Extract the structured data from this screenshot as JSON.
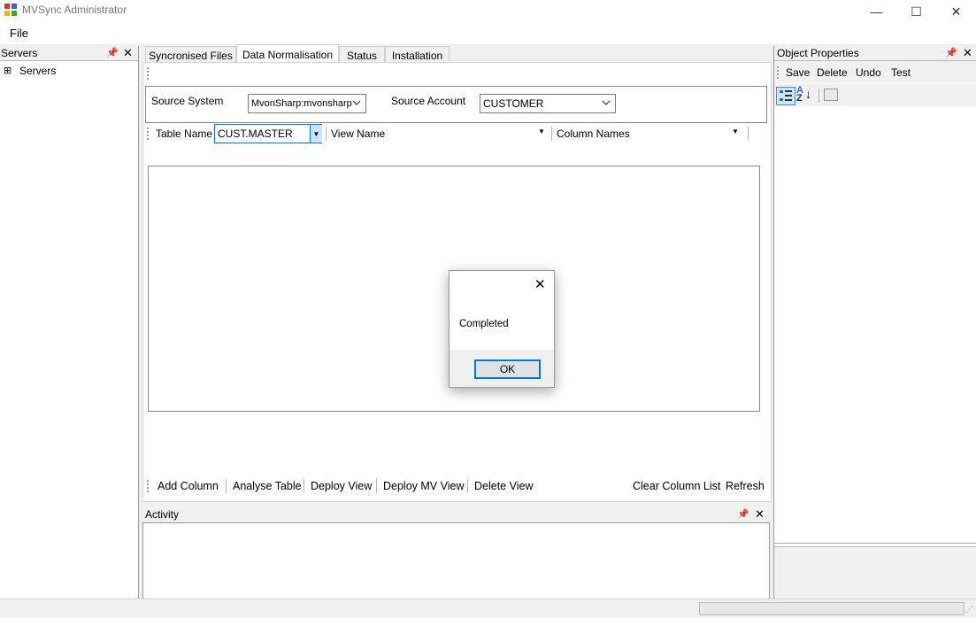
{
  "window": {
    "title": "MVSync Administrator"
  },
  "menu": {
    "file": "File"
  },
  "servers": {
    "title": "Servers",
    "tree_root": "Servers",
    "expander": "⊞"
  },
  "tabs": [
    "Syncronised Files",
    "Data Normalisation",
    "Status",
    "Installation"
  ],
  "form": {
    "source_system_label": "Source System",
    "source_system_value": "MvonSharp:mvonsharp",
    "source_account_label": "Source Account",
    "source_account_value": "CUSTOMER",
    "table_name_label": "Table Name",
    "table_name_value": "CUST.MASTER",
    "view_name_label": "View Name",
    "column_names_label": "Column Names"
  },
  "actions": [
    "Add Column",
    "Analyse Table",
    "Deploy View",
    "Deploy MV View",
    "Delete View"
  ],
  "actions_right": [
    "Clear Column List",
    "Refresh"
  ],
  "activity": {
    "title": "Activity"
  },
  "properties": {
    "title": "Object Properties",
    "toolbar": [
      "Save",
      "Delete",
      "Undo",
      "Test"
    ]
  },
  "dialog": {
    "message": "Completed",
    "ok": "OK"
  },
  "colors": {
    "accent": "#0078d7"
  }
}
